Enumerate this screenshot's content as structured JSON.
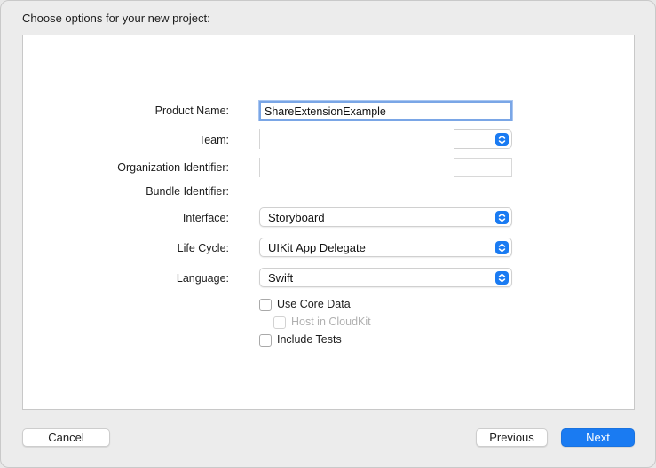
{
  "dialog": {
    "heading": "Choose options for your new project:"
  },
  "form": {
    "product_name": {
      "label": "Product Name:",
      "value": "ShareExtensionExample"
    },
    "team": {
      "label": "Team:",
      "value": ""
    },
    "organization_identifier": {
      "label": "Organization Identifier:",
      "value": ""
    },
    "bundle_identifier": {
      "label": "Bundle Identifier:",
      "value": ""
    },
    "interface": {
      "label": "Interface:",
      "value": "Storyboard"
    },
    "life_cycle": {
      "label": "Life Cycle:",
      "value": "UIKit App Delegate"
    },
    "language": {
      "label": "Language:",
      "value": "Swift"
    },
    "use_core_data": {
      "label": "Use Core Data",
      "checked": false
    },
    "host_in_cloudkit": {
      "label": "Host in CloudKit",
      "checked": false,
      "enabled": false
    },
    "include_tests": {
      "label": "Include Tests",
      "checked": false
    }
  },
  "footer": {
    "cancel_label": "Cancel",
    "previous_label": "Previous",
    "next_label": "Next"
  },
  "colors": {
    "accent": "#1a7bf2",
    "focus_ring": "#7aa6e6"
  },
  "icons": {
    "popup_indicator": "chevron-up-down-icon"
  }
}
